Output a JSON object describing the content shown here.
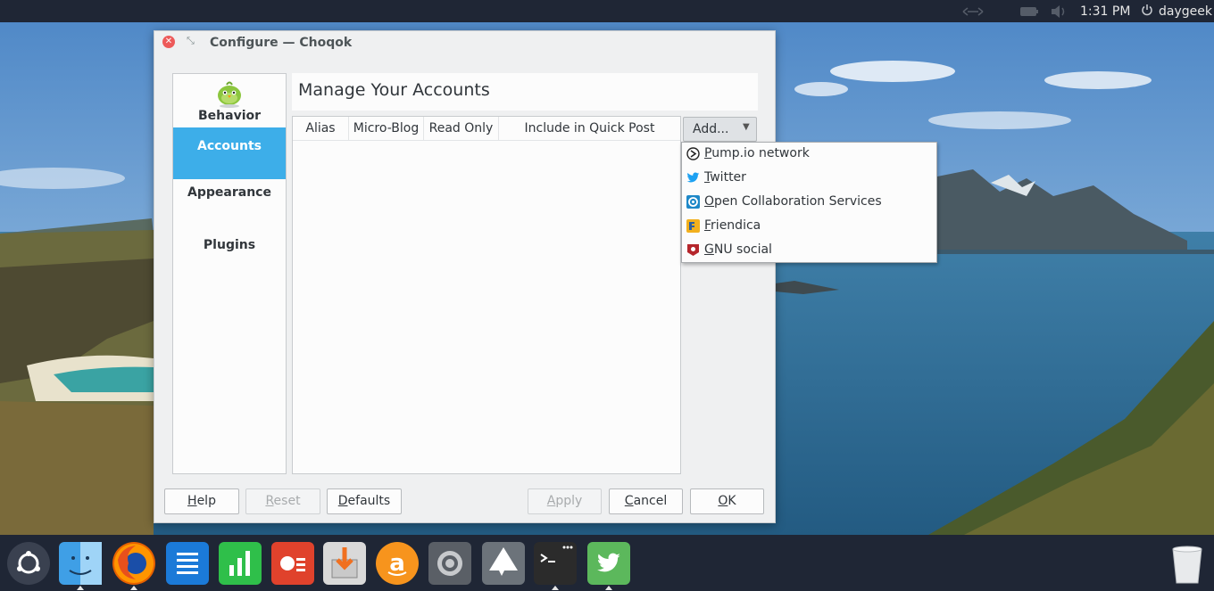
{
  "top_panel": {
    "clock": "1:31 PM",
    "user": "daygeek",
    "indicators": [
      "network-icon",
      "battery-icon",
      "volume-icon",
      "power-icon"
    ]
  },
  "window": {
    "title": "Configure — Choqok",
    "sidebar": {
      "items": [
        {
          "label": "Behavior",
          "active": false
        },
        {
          "label": "Accounts",
          "active": true
        },
        {
          "label": "Appearance",
          "active": false
        },
        {
          "label": "Plugins",
          "active": false
        }
      ]
    },
    "page_title": "Manage Your Accounts",
    "table": {
      "columns": [
        "Alias",
        "Micro-Blog",
        "Read Only",
        "Include in Quick Post"
      ],
      "rows": []
    },
    "add_button": {
      "label": "Add..."
    },
    "add_menu": {
      "items": [
        {
          "label": "Pump.io network",
          "icon": "pumpio-icon"
        },
        {
          "label": "Twitter",
          "icon": "twitter-icon"
        },
        {
          "label": "Open Collaboration Services",
          "icon": "ocs-icon"
        },
        {
          "label": "Friendica",
          "icon": "friendica-icon"
        },
        {
          "label": "GNU social",
          "icon": "gnusocial-icon"
        }
      ]
    },
    "buttons": {
      "help": {
        "label": "Help",
        "enabled": true
      },
      "reset": {
        "label": "Reset",
        "enabled": false
      },
      "defaults": {
        "label": "Defaults",
        "enabled": true
      },
      "apply": {
        "label": "Apply",
        "enabled": false
      },
      "cancel": {
        "label": "Cancel",
        "enabled": true
      },
      "ok": {
        "label": "OK",
        "enabled": true
      }
    }
  },
  "dock": {
    "apps": [
      "launcher-icon",
      "finder-icon",
      "firefox-icon",
      "writer-icon",
      "calc-icon",
      "impress-icon",
      "software-installer-icon",
      "amazon-icon",
      "settings-icon",
      "inkscape-icon",
      "terminal-icon",
      "choqok-icon",
      "trash-icon"
    ]
  },
  "colors": {
    "accent": "#3daee9",
    "panel": "#1f2635",
    "window_bg": "#eff0f1"
  }
}
